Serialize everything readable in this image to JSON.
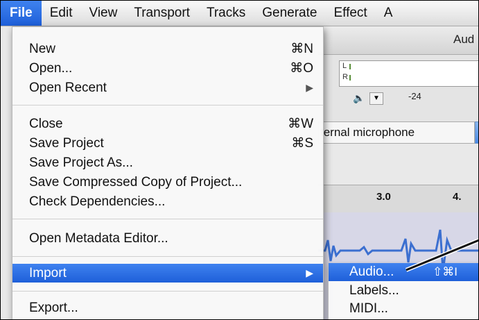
{
  "menubar": {
    "items": [
      "File",
      "Edit",
      "View",
      "Transport",
      "Tracks",
      "Generate",
      "Effect",
      "A"
    ]
  },
  "background": {
    "window_title": "Aud",
    "meter_left": "L",
    "meter_right": "R",
    "meter_tick": "-24",
    "input_device": "ternal microphone",
    "ruler_label_1": "3.0",
    "ruler_label_2": "4."
  },
  "file_menu": {
    "new": "New",
    "new_sc": "⌘N",
    "open": "Open...",
    "open_sc": "⌘O",
    "open_recent": "Open Recent",
    "close": "Close",
    "close_sc": "⌘W",
    "save_project": "Save Project",
    "save_project_sc": "⌘S",
    "save_project_as": "Save Project As...",
    "save_compressed": "Save Compressed Copy of Project...",
    "check_dependencies": "Check Dependencies...",
    "open_metadata": "Open Metadata Editor...",
    "import": "Import",
    "export": "Export..."
  },
  "import_submenu": {
    "audio": "Audio...",
    "audio_sc": "⇧⌘I",
    "labels": "Labels...",
    "midi": "MIDI..."
  },
  "icons": {
    "submenu_arrow": "▶",
    "volume": "🔈",
    "dropdown": "▼"
  }
}
